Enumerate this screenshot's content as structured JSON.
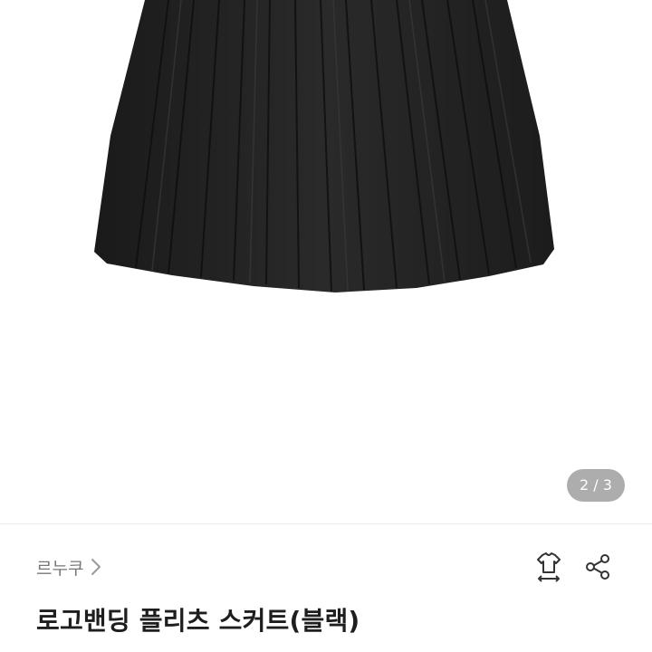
{
  "gallery": {
    "image_alt": "black pleated skirt",
    "current_index": "2",
    "total": "3",
    "counter_text": "2 / 3"
  },
  "product": {
    "brand": "르누쿠",
    "title": "로고밴딩 플리츠 스커트(블랙)"
  },
  "icons": {
    "brand_chevron": "chevron-right-icon",
    "size_guide": "size-guide-icon",
    "share": "share-icon"
  },
  "colors": {
    "skirt": "#232323",
    "counter_bg": "#5a5a5a",
    "brand_text": "#777777",
    "title_text": "#1e1e1e"
  }
}
